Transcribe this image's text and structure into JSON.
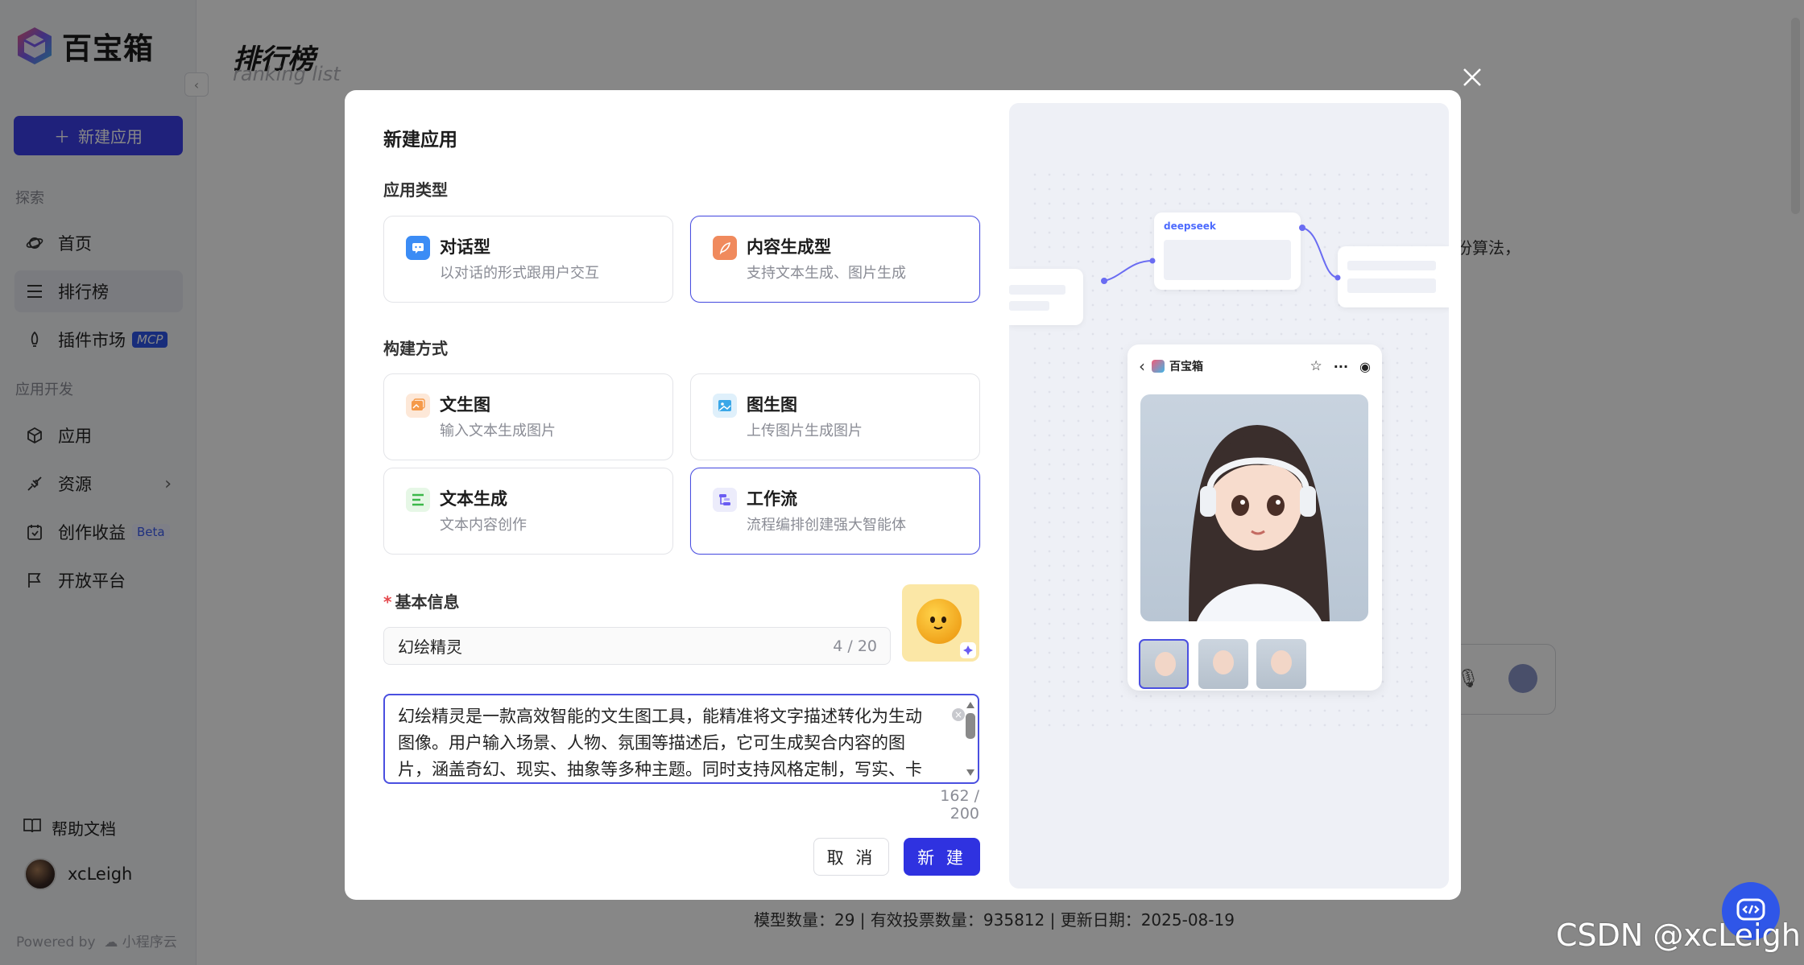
{
  "app": {
    "brand": "百宝箱",
    "new_app_label": "新建应用",
    "powered_by": "Powered by",
    "powered_brand": "小程序云"
  },
  "sidebar": {
    "section_explore": "探索",
    "section_dev": "应用开发",
    "items": [
      {
        "label": "首页",
        "icon": "planet-icon"
      },
      {
        "label": "排行榜",
        "icon": "list-icon"
      },
      {
        "label": "插件市场",
        "icon": "rocket-icon",
        "badge": "MCP"
      },
      {
        "label": "应用",
        "icon": "cube-icon"
      },
      {
        "label": "资源",
        "icon": "plug-icon"
      },
      {
        "label": "创作收益",
        "icon": "calendar-icon",
        "badge": "Beta"
      },
      {
        "label": "开放平台",
        "icon": "flag-icon"
      }
    ],
    "help": "帮助文档",
    "user": "xcLeigh"
  },
  "page": {
    "title": "排行榜",
    "subtitle": "ranking list",
    "bg_text": "份算法，",
    "footer_stats": "模型数量：29 | 有效投票数量：935812 | 更新日期：2025-08-19"
  },
  "modal": {
    "title": "新建应用",
    "type_label": "应用类型",
    "types": [
      {
        "title": "对话型",
        "desc": "以对话的形式跟用户交互",
        "selected": false
      },
      {
        "title": "内容生成型",
        "desc": "支持文本生成、图片生成",
        "selected": true
      }
    ],
    "build_label": "构建方式",
    "builds": [
      {
        "title": "文生图",
        "desc": "输入文本生成图片",
        "selected": false
      },
      {
        "title": "图生图",
        "desc": "上传图片生成图片",
        "selected": false
      },
      {
        "title": "文本生成",
        "desc": "文本内容创作",
        "selected": false
      },
      {
        "title": "工作流",
        "desc": "流程编排创建强大智能体",
        "selected": true
      }
    ],
    "basic_label": "基本信息",
    "required_mark": "*",
    "name_value": "幻绘精灵",
    "name_count": "4 / 20",
    "desc_value": "幻绘精灵是一款高效智能的文生图工具，能精准将文字描述转化为生动图像。用户输入场景、人物、氛围等描述后，它可生成契合内容的图片，涵盖奇幻、现实、抽象等多种主题。同时支持风格定制，写实、卡",
    "desc_count": "162 / 200",
    "cancel": "取 消",
    "create": "新 建"
  },
  "preview": {
    "node_brand": "deepseek",
    "phone_brand": "百宝箱"
  },
  "watermark": "CSDN @xcLeigh",
  "colors": {
    "primary": "#3b3fe8",
    "selected_border": "#4a4fe0",
    "create_button": "#2f32e0"
  }
}
